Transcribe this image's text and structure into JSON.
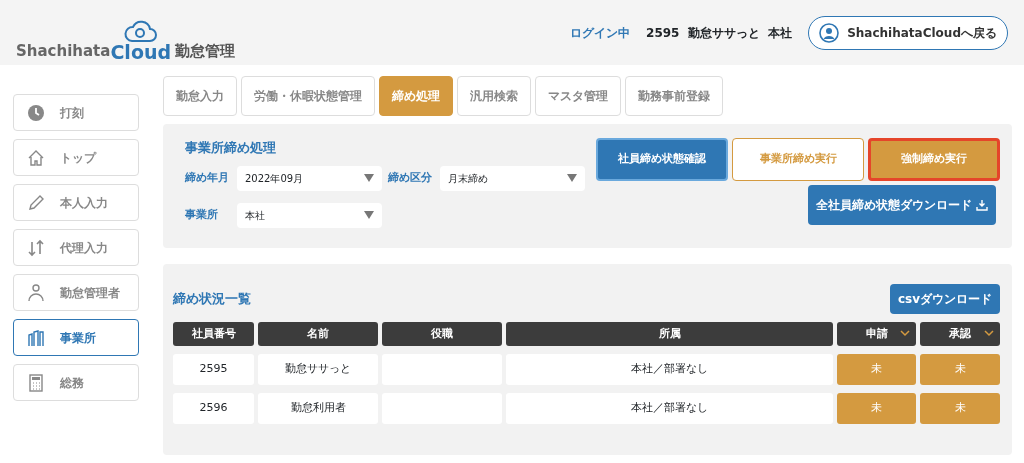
{
  "header": {
    "logo": {
      "brand": "Shachihata",
      "product": "Cloud",
      "app": "勤怠管理"
    },
    "login_label": "ログイン中",
    "user_info": "2595  勤怠ササっと  本社",
    "back_button": "ShachihataCloudへ戻る"
  },
  "sidebar": {
    "items": [
      {
        "label": "打刻",
        "selected": false
      },
      {
        "label": "トップ",
        "selected": false
      },
      {
        "label": "本人入力",
        "selected": false
      },
      {
        "label": "代理入力",
        "selected": false
      },
      {
        "label": "勤怠管理者",
        "selected": false
      },
      {
        "label": "事業所",
        "selected": true
      },
      {
        "label": "総務",
        "selected": false
      }
    ]
  },
  "tabs": [
    {
      "label": "勤怠入力",
      "selected": false
    },
    {
      "label": "労働・休暇状態管理",
      "selected": false
    },
    {
      "label": "締め処理",
      "selected": true
    },
    {
      "label": "汎用検索",
      "selected": false
    },
    {
      "label": "マスタ管理",
      "selected": false
    },
    {
      "label": "勤務事前登録",
      "selected": false
    }
  ],
  "closing_panel": {
    "title": "事業所締め処理",
    "fields": [
      {
        "label": "締め年月",
        "value": "2022年09月"
      },
      {
        "label": "締め区分",
        "value": "月末締め"
      },
      {
        "label": "事業所",
        "value": "本社"
      }
    ],
    "buttons": [
      {
        "label": "社員締め状態確認",
        "kind": "primary",
        "highlighted": false
      },
      {
        "label": "事業所締め実行",
        "kind": "outline",
        "highlighted": false
      },
      {
        "label": "強制締め実行",
        "kind": "warning",
        "highlighted": true
      }
    ],
    "download_button": "全社員締め状態ダウンロード"
  },
  "status_panel": {
    "title": "締め状況一覧",
    "csv_button": "csvダウンロード",
    "table": {
      "columns": [
        {
          "label": "社員番号",
          "dropdown": false
        },
        {
          "label": "名前",
          "dropdown": false
        },
        {
          "label": "役職",
          "dropdown": false
        },
        {
          "label": "所属",
          "dropdown": false
        },
        {
          "label": "申請",
          "dropdown": true
        },
        {
          "label": "承認",
          "dropdown": true
        }
      ],
      "rows": [
        {
          "cells": [
            "2595",
            "勤怠ササっと",
            "",
            "本社／部署なし",
            "未",
            "未"
          ]
        },
        {
          "cells": [
            "2596",
            "勤怠利用者",
            "",
            "本社／部署なし",
            "未",
            "未"
          ]
        }
      ]
    }
  }
}
